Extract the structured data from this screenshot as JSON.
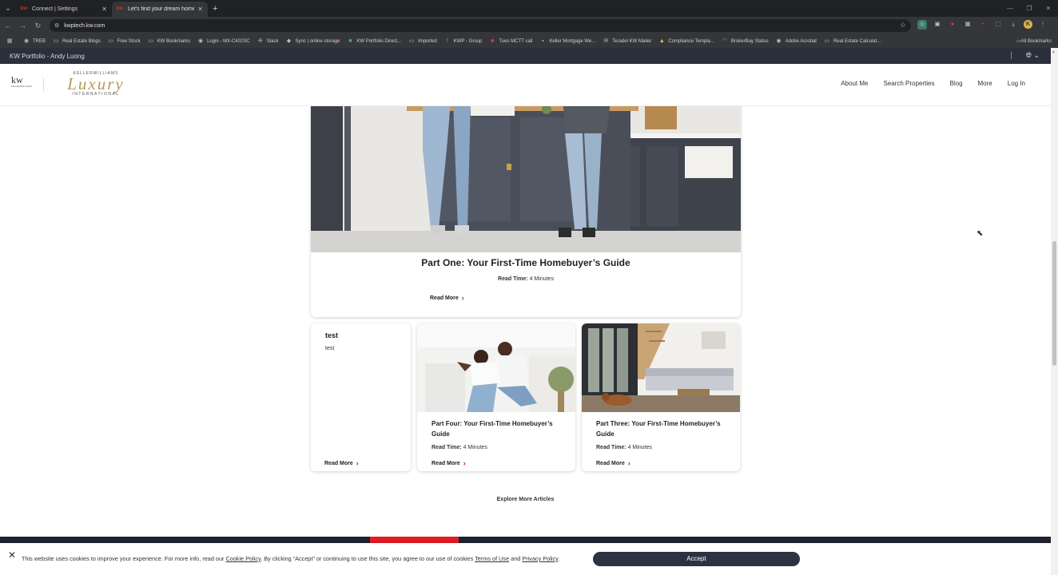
{
  "browser": {
    "tabs": [
      {
        "label": "Connect | Settings",
        "favicon": "kw-favicon",
        "active": false
      },
      {
        "label": "Let's find your dream home - Yo",
        "favicon": "kw-favicon",
        "active": true
      }
    ],
    "url": "kwptech.kw.com",
    "bookmarks": [
      {
        "label": "TREB",
        "icon": "globe-icon"
      },
      {
        "label": "Real Estate Blogs",
        "icon": "folder-icon"
      },
      {
        "label": "Free Stock",
        "icon": "folder-icon"
      },
      {
        "label": "KW Bookmarks",
        "icon": "folder-icon"
      },
      {
        "label": "Login - MX-C402SC",
        "icon": "globe-icon"
      },
      {
        "label": "Slack",
        "icon": "slack-icon"
      },
      {
        "label": "Sync | online storage",
        "icon": "sync-icon"
      },
      {
        "label": "KW Portfolio Direct...",
        "icon": "kw-icon"
      },
      {
        "label": "Imported",
        "icon": "folder-icon"
      },
      {
        "label": "KWP - Group",
        "icon": "facebook-icon"
      },
      {
        "label": "Tues MCTT call",
        "icon": "kw-icon"
      },
      {
        "label": "Keller Mortgage We...",
        "icon": "kw-icon"
      },
      {
        "label": "Teradel KW Mailer",
        "icon": "mail-icon"
      },
      {
        "label": "Compliance Templa...",
        "icon": "drive-icon"
      },
      {
        "label": "BrokerBay Status",
        "icon": "wifi-icon"
      },
      {
        "label": "Adobe Acrobat",
        "icon": "globe-icon"
      },
      {
        "label": "Real Estate Calculat...",
        "icon": "folder-icon"
      }
    ],
    "all_bookmarks": "All Bookmarks",
    "profile_initial": "K"
  },
  "kwbar": {
    "title": "KW Portfolio - Andy Luong"
  },
  "header": {
    "logo_kw": "kw",
    "logo_kw_sub": "KELLERWILLIAMS",
    "logo_top": "KELLERWILLIAMS",
    "logo_main": "Luxury",
    "logo_bottom": "INTERNATIONAL",
    "nav": [
      "About Me",
      "Search Properties",
      "Blog",
      "More",
      "Log In"
    ]
  },
  "featured": {
    "title": "Part One: Your First-Time Homebuyer’s Guide",
    "read_time_label": "Read Time:",
    "read_time_value": "4 Minutes",
    "read_more": "Read More"
  },
  "cards": [
    {
      "title": "test",
      "body": "test",
      "read_more": "Read More"
    },
    {
      "title": "Part Four: Your First-Time Homebuyer’s Guide",
      "read_time_label": "Read Time:",
      "read_time_value": "4 Minutes",
      "read_more": "Read More"
    },
    {
      "title": "Part Three: Your First-Time Homebuyer’s Guide",
      "read_time_label": "Read Time:",
      "read_time_value": "4 Minutes",
      "read_more": "Read More"
    }
  ],
  "explore_label": "Explore More Articles",
  "cookie": {
    "text_1": "This website uses cookies to improve your experience. For more info, read our ",
    "cookie_policy": "Cookie Policy",
    "text_2": ". By clicking “Accept” or continuing to use this site, you agree to our use of cookies ",
    "terms": "Terms of Use",
    "text_3": " and ",
    "privacy": "Privacy Policy",
    "text_4": ".",
    "accept": "Accept"
  },
  "colors": {
    "accent_red": "#e31b23",
    "navy": "#2d3142",
    "gold": "#b89a5a"
  }
}
